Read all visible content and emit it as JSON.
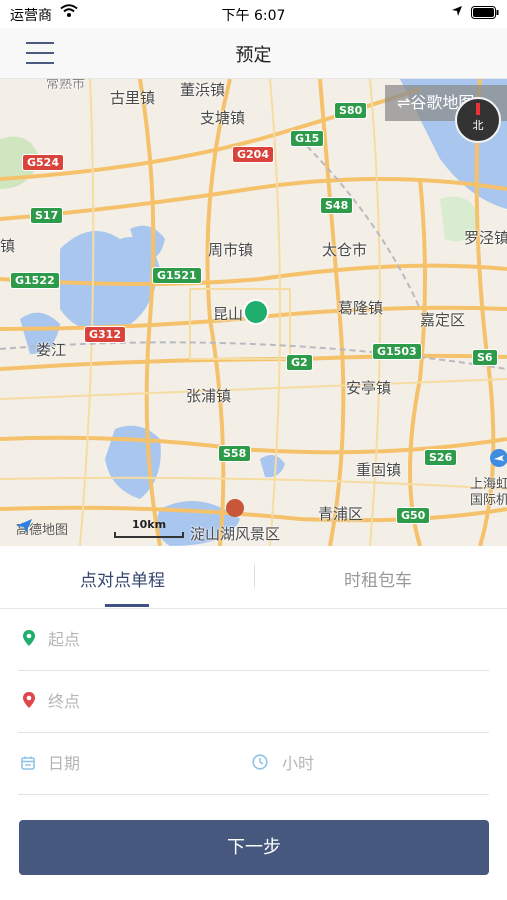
{
  "status_bar": {
    "carrier": "运营商",
    "time": "下午 6:07"
  },
  "nav": {
    "title": "预定"
  },
  "map": {
    "switch_label": "⇌谷歌地图",
    "compass_label": "北",
    "logo_text": "高德地图",
    "scale_label": "10km",
    "place_labels": [
      "古里镇",
      "董浜镇",
      "支塘镇",
      "周市镇",
      "太仓市",
      "罗泾镇",
      "昆山",
      "葛隆镇",
      "嘉定区",
      "娄江",
      "张浦镇",
      "安亭镇",
      "重固镇",
      "上海虹",
      "国际机",
      "青浦区",
      "淀山湖风景区",
      "常熟市",
      "镇"
    ],
    "road_shields": [
      "S80",
      "G15",
      "G204",
      "G524",
      "S48",
      "S17",
      "G1522",
      "G1521",
      "G312",
      "G2",
      "G1503",
      "S6",
      "S58",
      "S26",
      "G50"
    ]
  },
  "tabs": {
    "point_to_point": "点对点单程",
    "hourly_rental": "时租包车"
  },
  "form": {
    "start_placeholder": "起点",
    "end_placeholder": "终点",
    "date_placeholder": "日期",
    "hours_placeholder": "小时"
  },
  "next_button": "下一步",
  "colors": {
    "primary": "#47587f",
    "start_marker": "#1fae6b",
    "end_marker": "#e0464b",
    "date_icon": "#8fc3e6"
  }
}
